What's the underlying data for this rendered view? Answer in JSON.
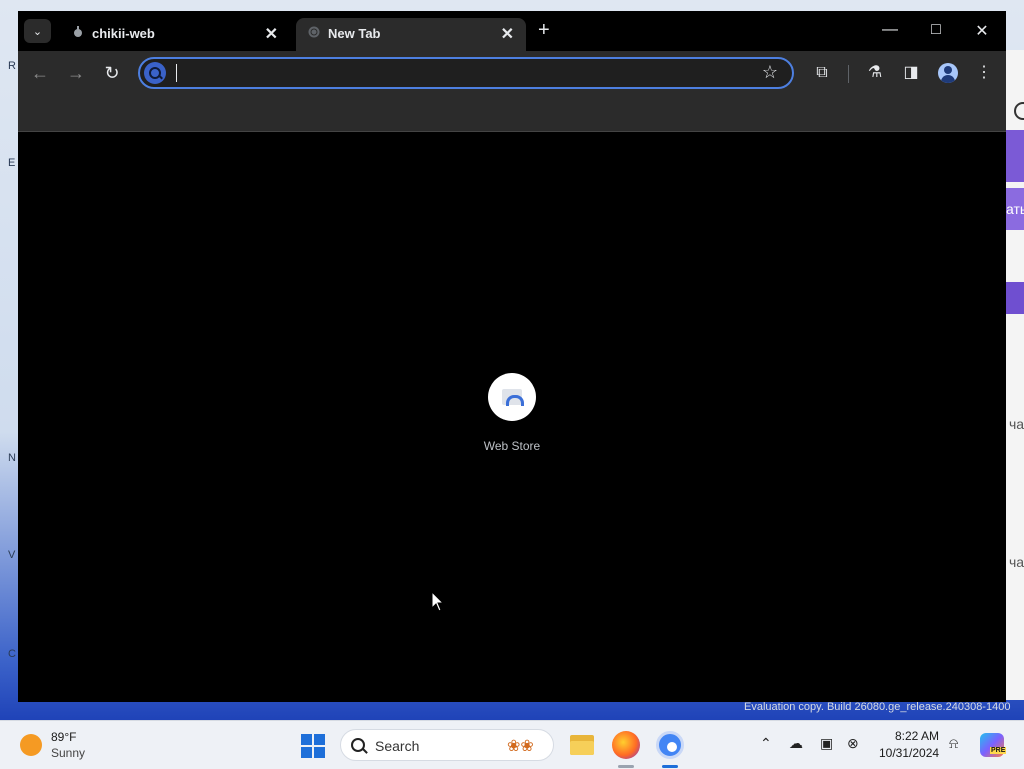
{
  "browser": {
    "tabs": [
      {
        "title": "chikii-web",
        "active": false
      },
      {
        "title": "New Tab",
        "active": true
      }
    ],
    "omnibox": {
      "value": "",
      "placeholder": ""
    },
    "new_tab_page": {
      "shortcuts": [
        {
          "label": "Web Store",
          "icon": "web-store-icon"
        }
      ]
    },
    "window_controls": [
      "minimize",
      "maximize",
      "close"
    ]
  },
  "watermark": "Evaluation copy. Build 26080.ge_release.240308-1400",
  "taskbar": {
    "weather": {
      "temp": "89°F",
      "condition": "Sunny"
    },
    "search_label": "Search",
    "clock": {
      "time": "8:22 AM",
      "date": "10/31/2024"
    },
    "copilot_badge": "PRE"
  },
  "background_app": {
    "text_fragments": [
      "ать",
      "ча",
      "ча"
    ]
  },
  "colors": {
    "accent": "#4d7fe0",
    "tab_bg": "#2b2b2b",
    "window_bg": "#000000",
    "windows_blue": "#1e6fd9"
  }
}
